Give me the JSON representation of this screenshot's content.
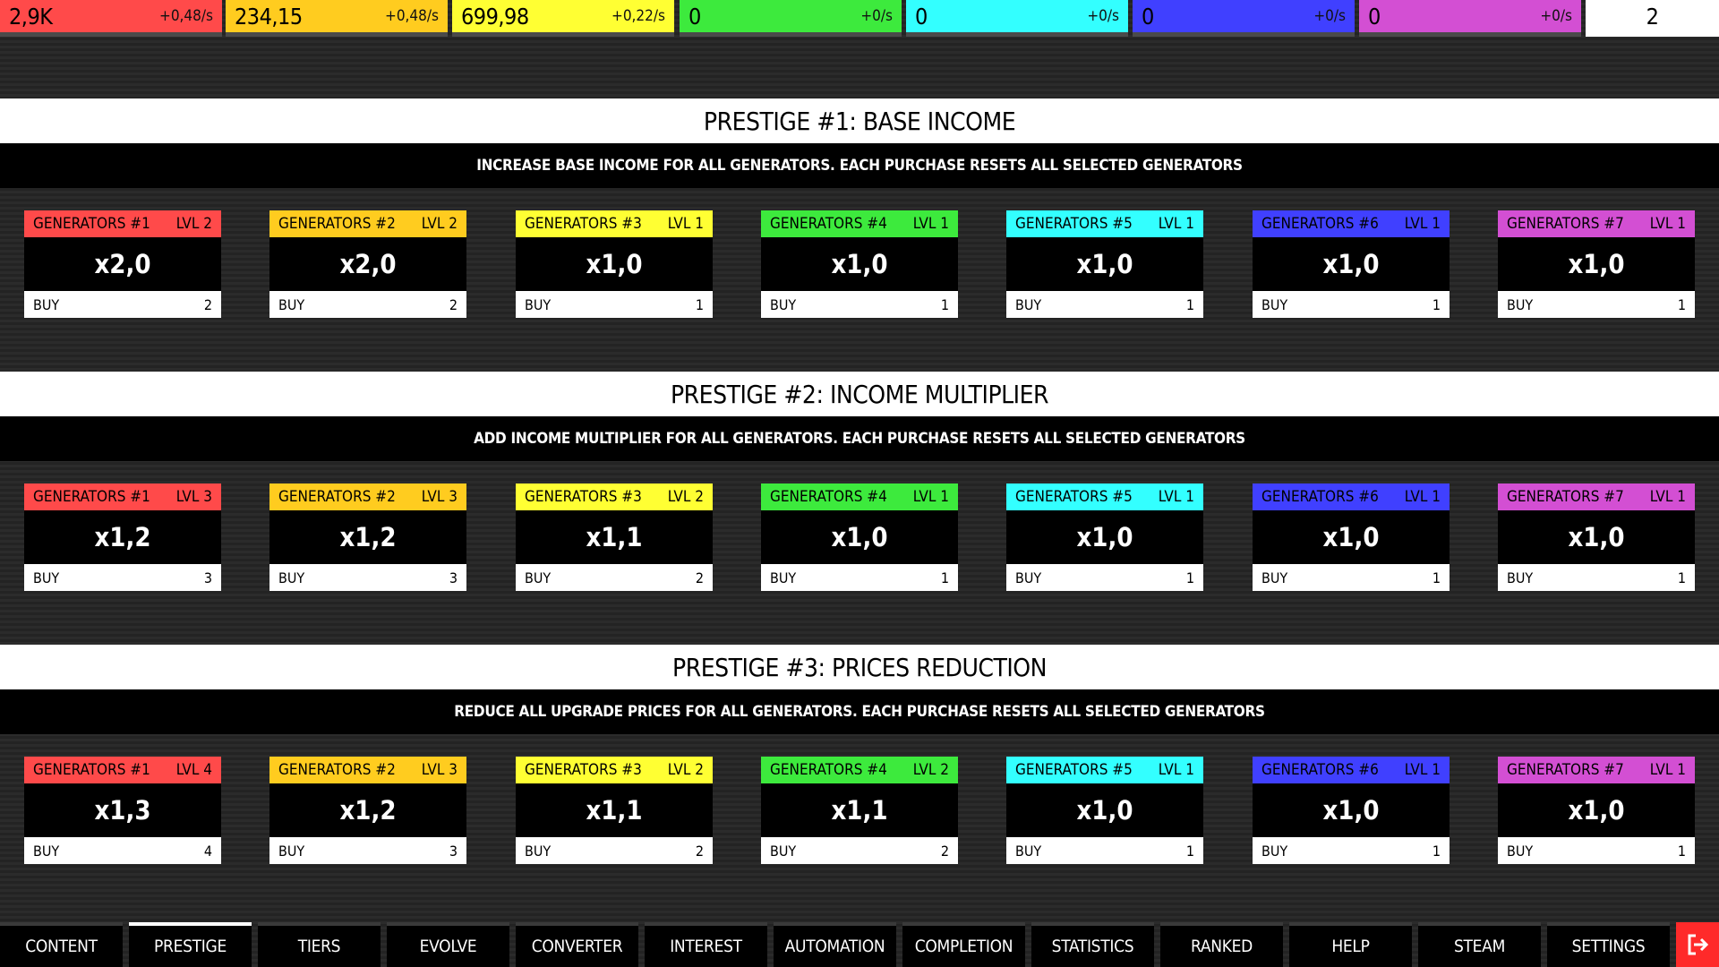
{
  "resources": [
    {
      "amount": "2,9K",
      "rate": "+0,48/s",
      "color": "#ff4a4a"
    },
    {
      "amount": "234,15",
      "rate": "+0,48/s",
      "color": "#ffcc1f"
    },
    {
      "amount": "699,98",
      "rate": "+0,22/s",
      "color": "#ffff33"
    },
    {
      "amount": "0",
      "rate": "+0/s",
      "color": "#3dea3d"
    },
    {
      "amount": "0",
      "rate": "+0/s",
      "color": "#33ffff"
    },
    {
      "amount": "0",
      "rate": "+0/s",
      "color": "#4040ff"
    },
    {
      "amount": "0",
      "rate": "+0/s",
      "color": "#d34fd3"
    }
  ],
  "counter": "2",
  "sections": [
    {
      "title": "PRESTIGE #1: BASE INCOME",
      "description": "INCREASE BASE INCOME FOR ALL GENERATORS. EACH PURCHASE RESETS ALL SELECTED GENERATORS",
      "cards": [
        {
          "name": "GENERATORS #1",
          "level": "LVL 2",
          "value": "x2,0",
          "buy": "BUY",
          "cost": "2"
        },
        {
          "name": "GENERATORS #2",
          "level": "LVL 2",
          "value": "x2,0",
          "buy": "BUY",
          "cost": "2"
        },
        {
          "name": "GENERATORS #3",
          "level": "LVL 1",
          "value": "x1,0",
          "buy": "BUY",
          "cost": "1"
        },
        {
          "name": "GENERATORS #4",
          "level": "LVL 1",
          "value": "x1,0",
          "buy": "BUY",
          "cost": "1"
        },
        {
          "name": "GENERATORS #5",
          "level": "LVL 1",
          "value": "x1,0",
          "buy": "BUY",
          "cost": "1"
        },
        {
          "name": "GENERATORS #6",
          "level": "LVL 1",
          "value": "x1,0",
          "buy": "BUY",
          "cost": "1"
        },
        {
          "name": "GENERATORS #7",
          "level": "LVL 1",
          "value": "x1,0",
          "buy": "BUY",
          "cost": "1"
        }
      ]
    },
    {
      "title": "PRESTIGE #2: INCOME MULTIPLIER",
      "description": "ADD INCOME MULTIPLIER FOR ALL GENERATORS. EACH PURCHASE RESETS ALL SELECTED GENERATORS",
      "cards": [
        {
          "name": "GENERATORS #1",
          "level": "LVL 3",
          "value": "x1,2",
          "buy": "BUY",
          "cost": "3"
        },
        {
          "name": "GENERATORS #2",
          "level": "LVL 3",
          "value": "x1,2",
          "buy": "BUY",
          "cost": "3"
        },
        {
          "name": "GENERATORS #3",
          "level": "LVL 2",
          "value": "x1,1",
          "buy": "BUY",
          "cost": "2"
        },
        {
          "name": "GENERATORS #4",
          "level": "LVL 1",
          "value": "x1,0",
          "buy": "BUY",
          "cost": "1"
        },
        {
          "name": "GENERATORS #5",
          "level": "LVL 1",
          "value": "x1,0",
          "buy": "BUY",
          "cost": "1"
        },
        {
          "name": "GENERATORS #6",
          "level": "LVL 1",
          "value": "x1,0",
          "buy": "BUY",
          "cost": "1"
        },
        {
          "name": "GENERATORS #7",
          "level": "LVL 1",
          "value": "x1,0",
          "buy": "BUY",
          "cost": "1"
        }
      ]
    },
    {
      "title": "PRESTIGE #3: PRICES REDUCTION",
      "description": "REDUCE ALL UPGRADE PRICES FOR ALL GENERATORS. EACH PURCHASE RESETS ALL SELECTED GENERATORS",
      "cards": [
        {
          "name": "GENERATORS #1",
          "level": "LVL 4",
          "value": "x1,3",
          "buy": "BUY",
          "cost": "4"
        },
        {
          "name": "GENERATORS #2",
          "level": "LVL 3",
          "value": "x1,2",
          "buy": "BUY",
          "cost": "3"
        },
        {
          "name": "GENERATORS #3",
          "level": "LVL 2",
          "value": "x1,1",
          "buy": "BUY",
          "cost": "2"
        },
        {
          "name": "GENERATORS #4",
          "level": "LVL 2",
          "value": "x1,1",
          "buy": "BUY",
          "cost": "2"
        },
        {
          "name": "GENERATORS #5",
          "level": "LVL 1",
          "value": "x1,0",
          "buy": "BUY",
          "cost": "1"
        },
        {
          "name": "GENERATORS #6",
          "level": "LVL 1",
          "value": "x1,0",
          "buy": "BUY",
          "cost": "1"
        },
        {
          "name": "GENERATORS #7",
          "level": "LVL 1",
          "value": "x1,0",
          "buy": "BUY",
          "cost": "1"
        }
      ]
    }
  ],
  "generator_colors": [
    "#ff4a4a",
    "#ffcc1f",
    "#ffff33",
    "#3dea3d",
    "#33ffff",
    "#4040ff",
    "#d34fd3"
  ],
  "nav": {
    "tabs": [
      "CONTENT",
      "PRESTIGE",
      "TIERS",
      "EVOLVE",
      "CONVERTER",
      "INTEREST",
      "AUTOMATION",
      "COMPLETION",
      "STATISTICS",
      "RANKED",
      "HELP",
      "STEAM",
      "SETTINGS"
    ],
    "active": "PRESTIGE",
    "exit_icon": "exit-icon",
    "exit_color": "#ff2a2a"
  }
}
